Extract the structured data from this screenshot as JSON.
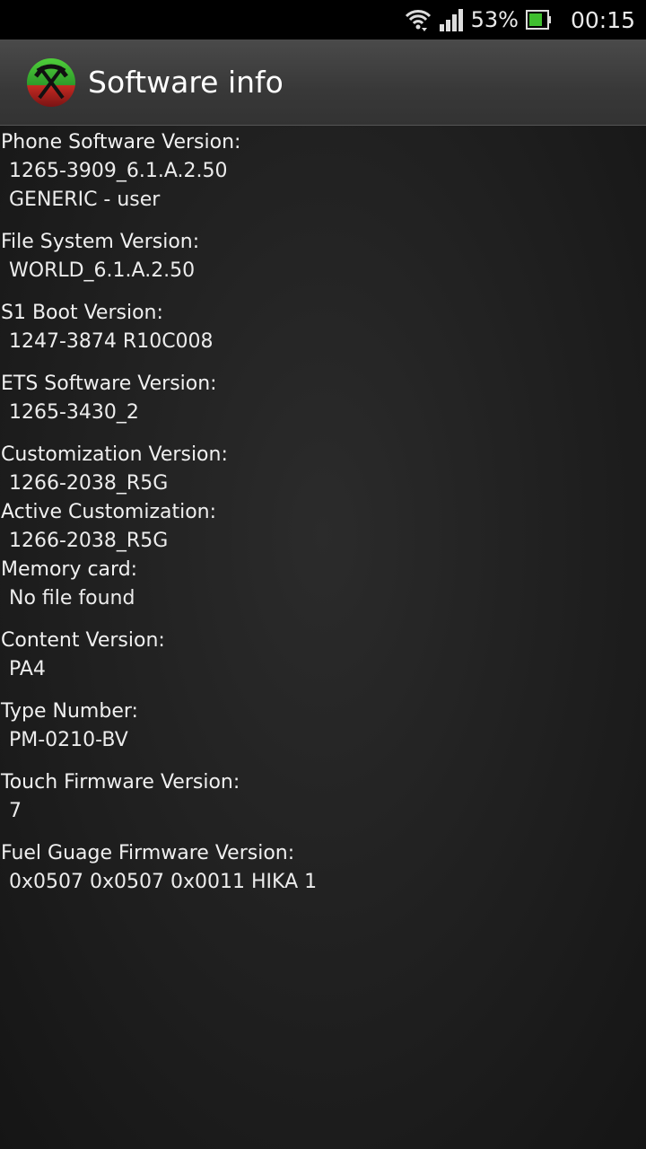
{
  "status_bar": {
    "battery_percent": "53%",
    "time": "00:15"
  },
  "action_bar": {
    "title": "Software info",
    "icon": "pickaxe-tools-icon"
  },
  "sections": [
    {
      "label": "Phone Software Version:",
      "values": [
        "1265-3909_6.1.A.2.50",
        "GENERIC - user"
      ]
    },
    {
      "label": "File System Version:",
      "values": [
        "WORLD_6.1.A.2.50"
      ]
    },
    {
      "label": "S1 Boot Version:",
      "values": [
        "1247-3874 R10C008"
      ]
    },
    {
      "label": "ETS Software Version:",
      "values": [
        "1265-3430_2"
      ]
    },
    {
      "label": "Customization Version:",
      "values": [
        "1266-2038_R5G"
      ]
    },
    {
      "label": "Active Customization:",
      "values": [
        "1266-2038_R5G"
      ]
    },
    {
      "label": "Memory card:",
      "values": [
        "No file found"
      ]
    },
    {
      "label": "Content Version:",
      "values": [
        "PA4"
      ]
    },
    {
      "label": "Type Number:",
      "values": [
        "PM-0210-BV"
      ]
    },
    {
      "label": "Touch Firmware Version:",
      "values": [
        "7"
      ]
    },
    {
      "label": "Fuel Guage Firmware Version:",
      "values": [
        "0x0507 0x0507 0x0011 HIKA 1"
      ]
    }
  ],
  "colors": {
    "battery_green": "#3fbf2f",
    "icon_green": "#2e9a2a",
    "icon_red": "#b82020"
  }
}
